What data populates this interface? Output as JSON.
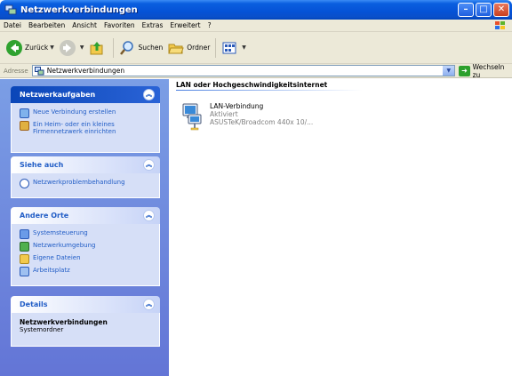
{
  "window": {
    "title": "Netzwerkverbindungen",
    "controls": {
      "minimize": "–",
      "maximize": "□",
      "close": "✕"
    }
  },
  "menu": {
    "items": [
      "Datei",
      "Bearbeiten",
      "Ansicht",
      "Favoriten",
      "Extras",
      "Erweitert",
      "?"
    ]
  },
  "toolbar": {
    "back_label": "Zurück",
    "search_label": "Suchen",
    "folders_label": "Ordner"
  },
  "address": {
    "label": "Adresse",
    "value": "Netzwerkverbindungen",
    "go_label": "Wechseln zu"
  },
  "sidebar": {
    "network_tasks": {
      "title": "Netzwerkaufgaben",
      "items": [
        {
          "label": "Neue Verbindung erstellen",
          "icon": "new-connection-icon"
        },
        {
          "label": "Ein Heim- oder ein kleines Firmennetzwerk einrichten",
          "icon": "home-network-icon"
        }
      ]
    },
    "see_also": {
      "title": "Siehe auch",
      "items": [
        {
          "label": "Netzwerkproblembehandlung",
          "icon": "troubleshoot-icon"
        }
      ]
    },
    "other_places": {
      "title": "Andere Orte",
      "items": [
        {
          "label": "Systemsteuerung",
          "icon": "control-panel-icon"
        },
        {
          "label": "Netzwerkumgebung",
          "icon": "network-places-icon"
        },
        {
          "label": "Eigene Dateien",
          "icon": "my-documents-icon"
        },
        {
          "label": "Arbeitsplatz",
          "icon": "my-computer-icon"
        }
      ]
    },
    "details": {
      "title": "Details",
      "name": "Netzwerkverbindungen",
      "type": "Systemordner"
    }
  },
  "main": {
    "group_header": "LAN oder Hochgeschwindigkeitsinternet",
    "connection": {
      "name": "LAN-Verbindung",
      "status": "Aktiviert",
      "device": "ASUSTeK/Broadcom 440x 10/..."
    }
  },
  "colors": {
    "title_bar": "#0552d6",
    "task_pane": "#6f8ade",
    "link": "#215dc6"
  }
}
